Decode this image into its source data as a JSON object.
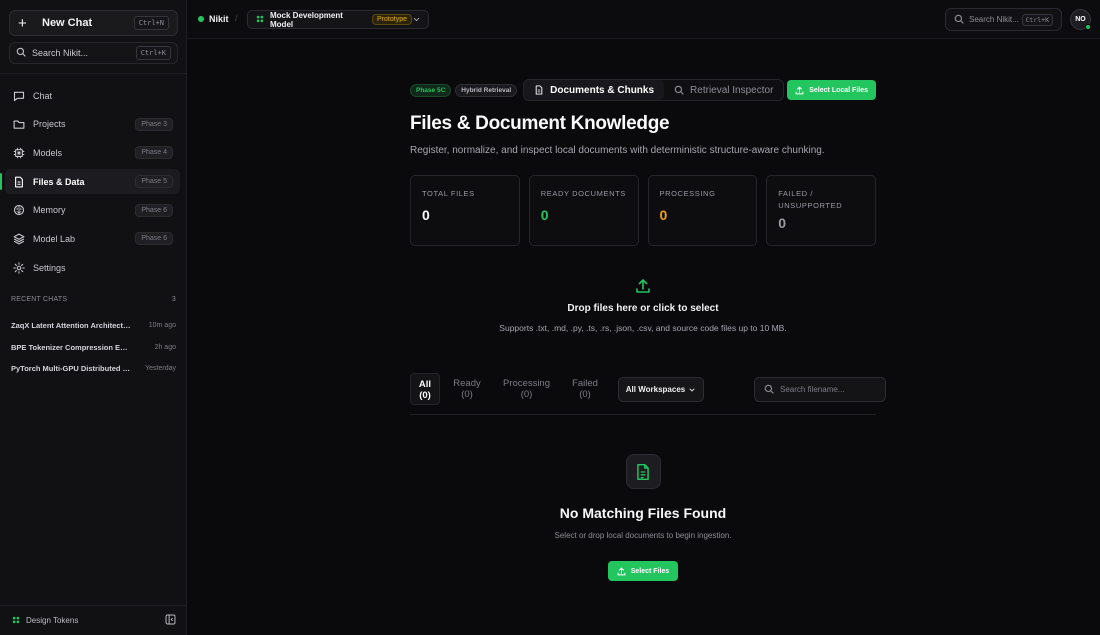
{
  "sidebar": {
    "new_chat": {
      "label": "New Chat",
      "shortcut": "Ctrl+N"
    },
    "search": {
      "placeholder": "Search Nikit...",
      "shortcut": "Ctrl+K"
    },
    "nav": [
      {
        "label": "Chat",
        "badge": "",
        "icon": "chat-icon"
      },
      {
        "label": "Projects",
        "badge": "Phase 3",
        "icon": "folder-icon"
      },
      {
        "label": "Models",
        "badge": "Phase 4",
        "icon": "chip-icon"
      },
      {
        "label": "Files & Data",
        "badge": "Phase 5",
        "icon": "file-icon",
        "active": true
      },
      {
        "label": "Memory",
        "badge": "Phase 6",
        "icon": "brain-icon"
      },
      {
        "label": "Model Lab",
        "badge": "Phase 6",
        "icon": "layers-icon"
      },
      {
        "label": "Settings",
        "badge": "",
        "icon": "gear-icon"
      }
    ],
    "recent_heading": "RECENT CHATS",
    "recent_count": "3",
    "recent": [
      {
        "title": "ZaqX Latent Attention Architecture Design",
        "time": "10m ago"
      },
      {
        "title": "BPE Tokenizer Compression Experiments",
        "time": "2h ago"
      },
      {
        "title": "PyTorch Multi-GPU Distributed Training",
        "time": "Yesterday"
      }
    ],
    "footer": {
      "label": "Design Tokens"
    }
  },
  "topbar": {
    "workspace": "Nikit",
    "separator": "/",
    "model": "Mock Development Model",
    "model_badge": "Prototype",
    "search_placeholder": "Search Nikit...",
    "search_shortcut": "Ctrl+K",
    "avatar": "NO"
  },
  "main": {
    "chips": [
      "Phase 5C",
      "Hybrid Retrieval"
    ],
    "tabs": [
      "Documents & Chunks",
      "Retrieval Inspector"
    ],
    "select_local": "Select Local Files",
    "title": "Files & Document Knowledge",
    "subtitle": "Register, normalize, and inspect local documents with deterministic structure-aware chunking.",
    "stats": [
      {
        "label": "TOTAL FILES",
        "value": "0",
        "color": "#ffffff"
      },
      {
        "label": "READY DOCUMENTS",
        "value": "0",
        "color": "#22c55e"
      },
      {
        "label": "PROCESSING",
        "value": "0",
        "color": "#f59e0b"
      },
      {
        "label": "FAILED / UNSUPPORTED",
        "value": "0",
        "color": "#9a9aa2"
      }
    ],
    "drop": {
      "title": "Drop files here or click to select",
      "subtitle": "Supports .txt, .md, .py, .ts, .rs, .json, .csv, and source code files up to 10 MB."
    },
    "filters": [
      {
        "label": "All",
        "count": "(0)"
      },
      {
        "label": "Ready",
        "count": "(0)"
      },
      {
        "label": "Processing",
        "count": "(0)"
      },
      {
        "label": "Failed",
        "count": "(0)"
      }
    ],
    "workspace_filter": "All Workspaces",
    "search_placeholder": "Search filename...",
    "empty": {
      "title": "No Matching Files Found",
      "subtitle": "Select or drop local documents to begin ingestion.",
      "button": "Select Files"
    }
  },
  "colors": {
    "accent": "#22c55e",
    "warning": "#eab308"
  }
}
